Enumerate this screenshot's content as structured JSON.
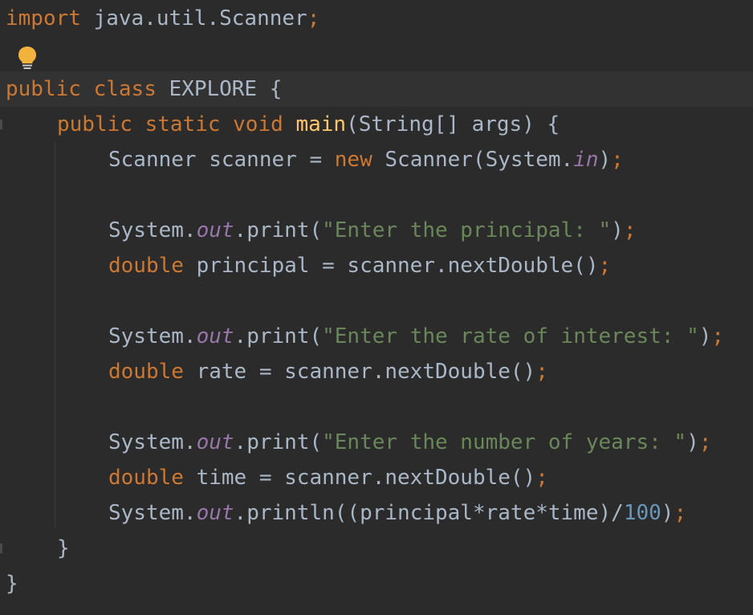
{
  "editor": {
    "lines": [
      [
        {
          "t": "import",
          "c": "kw"
        },
        {
          "t": " java.util.Scanner",
          "c": "plain"
        },
        {
          "t": ";",
          "c": "semi"
        }
      ],
      [],
      [
        {
          "t": "public",
          "c": "kw"
        },
        {
          "t": " ",
          "c": "plain"
        },
        {
          "t": "class",
          "c": "kw"
        },
        {
          "t": " EXPLORE {",
          "c": "plain"
        }
      ],
      [
        {
          "t": "public",
          "c": "kw"
        },
        {
          "t": " ",
          "c": "plain"
        },
        {
          "t": "static",
          "c": "kw"
        },
        {
          "t": " ",
          "c": "plain"
        },
        {
          "t": "void",
          "c": "kw"
        },
        {
          "t": " ",
          "c": "plain"
        },
        {
          "t": "main",
          "c": "method-decl"
        },
        {
          "t": "(String[] args) {",
          "c": "plain"
        }
      ],
      [
        {
          "t": "Scanner scanner = ",
          "c": "plain"
        },
        {
          "t": "new",
          "c": "kw"
        },
        {
          "t": " Scanner(System.",
          "c": "plain"
        },
        {
          "t": "in",
          "c": "static-field"
        },
        {
          "t": ")",
          "c": "plain"
        },
        {
          "t": ";",
          "c": "semi"
        }
      ],
      [],
      [
        {
          "t": "System.",
          "c": "plain"
        },
        {
          "t": "out",
          "c": "static-field"
        },
        {
          "t": ".print(",
          "c": "plain"
        },
        {
          "t": "\"Enter the principal: \"",
          "c": "str"
        },
        {
          "t": ")",
          "c": "plain"
        },
        {
          "t": ";",
          "c": "semi"
        }
      ],
      [
        {
          "t": "double",
          "c": "kw"
        },
        {
          "t": " principal = scanner.nextDouble()",
          "c": "plain"
        },
        {
          "t": ";",
          "c": "semi"
        }
      ],
      [],
      [
        {
          "t": "System.",
          "c": "plain"
        },
        {
          "t": "out",
          "c": "static-field"
        },
        {
          "t": ".print(",
          "c": "plain"
        },
        {
          "t": "\"Enter the rate of interest: \"",
          "c": "str"
        },
        {
          "t": ")",
          "c": "plain"
        },
        {
          "t": ";",
          "c": "semi"
        }
      ],
      [
        {
          "t": "double",
          "c": "kw"
        },
        {
          "t": " rate = scanner.nextDouble()",
          "c": "plain"
        },
        {
          "t": ";",
          "c": "semi"
        }
      ],
      [],
      [
        {
          "t": "System.",
          "c": "plain"
        },
        {
          "t": "out",
          "c": "static-field"
        },
        {
          "t": ".print(",
          "c": "plain"
        },
        {
          "t": "\"Enter the number of years: \"",
          "c": "str"
        },
        {
          "t": ")",
          "c": "plain"
        },
        {
          "t": ";",
          "c": "semi"
        }
      ],
      [
        {
          "t": "double",
          "c": "kw"
        },
        {
          "t": " time = scanner.nextDouble()",
          "c": "plain"
        },
        {
          "t": ";",
          "c": "semi"
        }
      ],
      [
        {
          "t": "System.",
          "c": "plain"
        },
        {
          "t": "out",
          "c": "static-field"
        },
        {
          "t": ".println((principal*rate*time)/",
          "c": "plain"
        },
        {
          "t": "100",
          "c": "num"
        },
        {
          "t": ")",
          "c": "plain"
        },
        {
          "t": ";",
          "c": "semi"
        }
      ],
      [
        {
          "t": "}",
          "c": "plain"
        }
      ],
      [
        {
          "t": "}",
          "c": "plain"
        }
      ]
    ],
    "intention_icon": "lightbulb-icon",
    "colors": {
      "background": "#2b2b2b",
      "current_line": "#323232",
      "keyword": "#cc7832",
      "text": "#a9b7c6",
      "method": "#ffc66d",
      "static_field": "#9876aa",
      "string": "#6a8759",
      "number": "#6897bb",
      "bulb": "#f2b33d"
    }
  }
}
